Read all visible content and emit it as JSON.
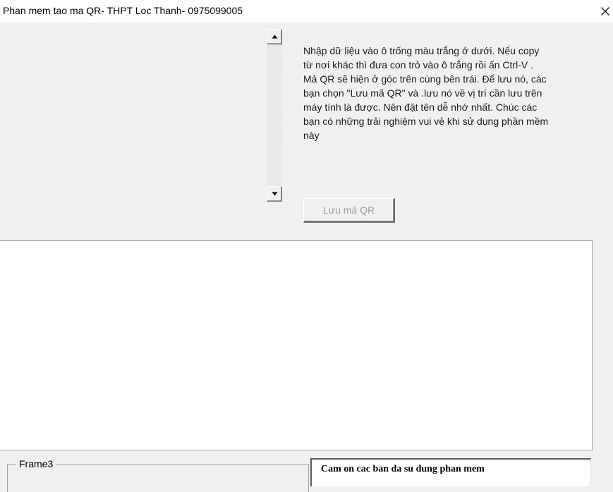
{
  "window": {
    "title": "Phan mem tao ma QR- THPT Loc Thanh- 0975099005",
    "close_icon": "close-icon"
  },
  "scrollbar": {
    "up_icon": "arrow-up-icon",
    "down_icon": "arrow-down-icon"
  },
  "instructions": {
    "text": "Nhập dữ liệu vào ô trống màu trắng  ở dưới. Nếu copy\ntừ nơi khác thì đưa con trỏ vào ô trắng rồi ấn Ctrl-V .\nMả QR sẽ hiện ở góc trên cùng bên trái. Để lưu nó, các\nbạn chọn \"Lưu mã QR\" và .lưu nó về vị trí cần lưu trên\nmáy tính là được. Nên  đặt tên dễ nhớ nhất. Chúc các\nbạn có những trải nghiệm vui vẻ khi sử dụng phần mềm\nnày"
  },
  "buttons": {
    "save_qr_label": "Lưu mã QR"
  },
  "input": {
    "value": ""
  },
  "frame": {
    "legend": "Frame3"
  },
  "message": {
    "text": "Cam on cac ban da su dung phan mem"
  },
  "colors": {
    "window_bg": "#f0f0f0",
    "titlebar_bg": "#ffffff",
    "disabled_text": "#a0a0a0",
    "input_bg": "#ffffff"
  }
}
